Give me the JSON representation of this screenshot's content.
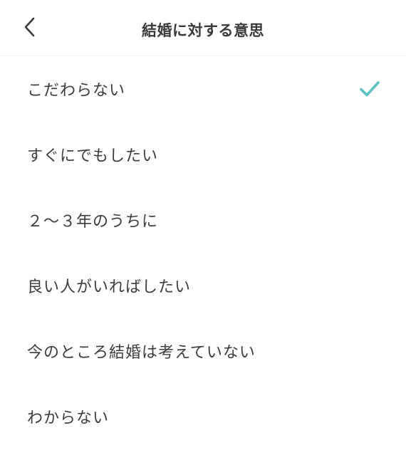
{
  "header": {
    "title": "結婚に対する意思",
    "back_icon": "chevron-left-icon"
  },
  "options": [
    {
      "label": "こだわらない",
      "selected": true
    },
    {
      "label": "すぐにでもしたい",
      "selected": false
    },
    {
      "label": "２〜３年のうちに",
      "selected": false
    },
    {
      "label": "良い人がいればしたい",
      "selected": false
    },
    {
      "label": "今のところ結婚は考えていない",
      "selected": false
    },
    {
      "label": "わからない",
      "selected": false
    }
  ],
  "colors": {
    "accent": "#5bbfc4",
    "text": "#3c3c3c",
    "background": "#ffffff"
  },
  "check_icon": "checkmark-icon"
}
